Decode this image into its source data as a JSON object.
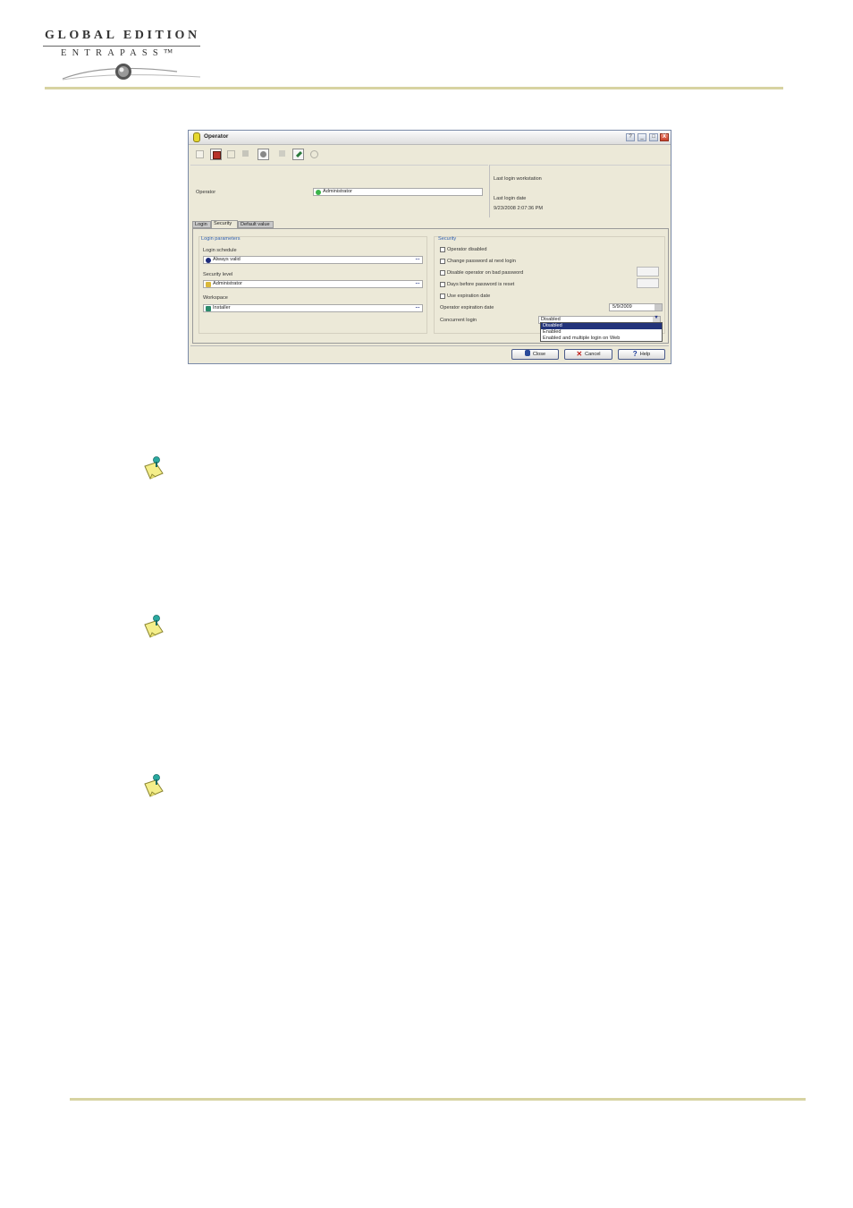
{
  "header": {
    "logo_line1": "GLOBAL EDITION",
    "logo_line2": "ENTRAPASS™"
  },
  "window": {
    "title": "Operator",
    "controls": [
      "?",
      "_",
      "□",
      "X"
    ],
    "toolbar_icons": [
      "new-icon",
      "save-icon",
      "copy-icon",
      "delete-icon",
      "print-icon",
      "grid-icon",
      "edit-icon",
      "find-icon"
    ],
    "operator_label": "Operator",
    "operator_value": "Administrator",
    "last_login_workstation_label": "Last login workstation",
    "last_login_date_label": "Last login date",
    "last_login_date_value": "9/23/2008 2:07:36 PM",
    "tabs": [
      "Login",
      "Security",
      "Default value"
    ],
    "active_tab": "Security",
    "login_parameters": {
      "title": "Login parameters",
      "login_schedule_label": "Login schedule",
      "login_schedule_value": "Always valid",
      "security_level_label": "Security level",
      "security_level_value": "Administrator",
      "workspace_label": "Workspace",
      "workspace_value": "Installer"
    },
    "security": {
      "title": "Security",
      "checkboxes": [
        "Operator disabled",
        "Change password at next login",
        "Disable operator on bad password",
        "Days before password is reset",
        "Use expiration date"
      ],
      "expiration_label": "Operator expiration date",
      "expiration_value": "5/9/2009",
      "concurrent_label": "Concurrent login",
      "concurrent_value": "Disabled",
      "concurrent_options": [
        "Disabled",
        "Enabled",
        "Enabled and multiple login on Web"
      ],
      "concurrent_selected": "Disabled"
    },
    "buttons": {
      "close": "Close",
      "cancel": "Cancel",
      "help": "Help"
    }
  },
  "notes": [
    "note-icon",
    "note-icon",
    "note-icon"
  ]
}
